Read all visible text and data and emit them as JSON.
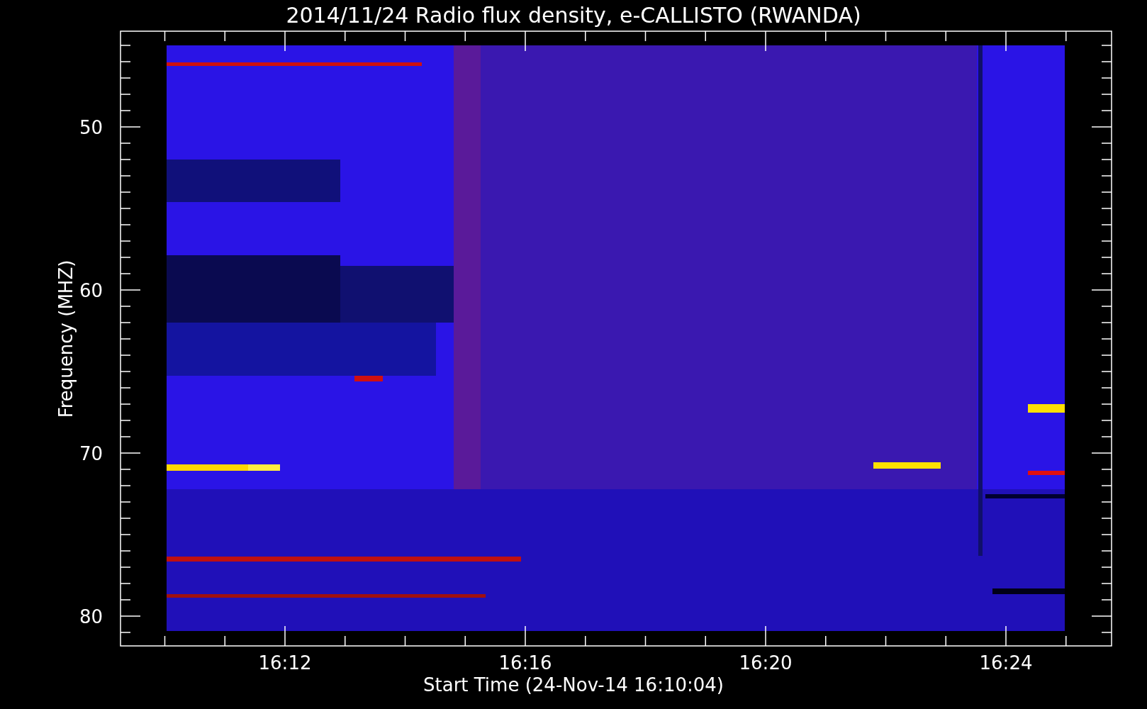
{
  "title": "2014/11/24  Radio flux density, e-CALLISTO (RWANDA)",
  "y_axis": {
    "label": "Frequency (MHZ)",
    "ticks": [
      "50",
      "60",
      "70",
      "80"
    ]
  },
  "x_axis": {
    "label": "Start Time (24-Nov-14 16:10:04)",
    "ticks": [
      "16:12",
      "16:16",
      "16:20",
      "16:24"
    ]
  }
}
